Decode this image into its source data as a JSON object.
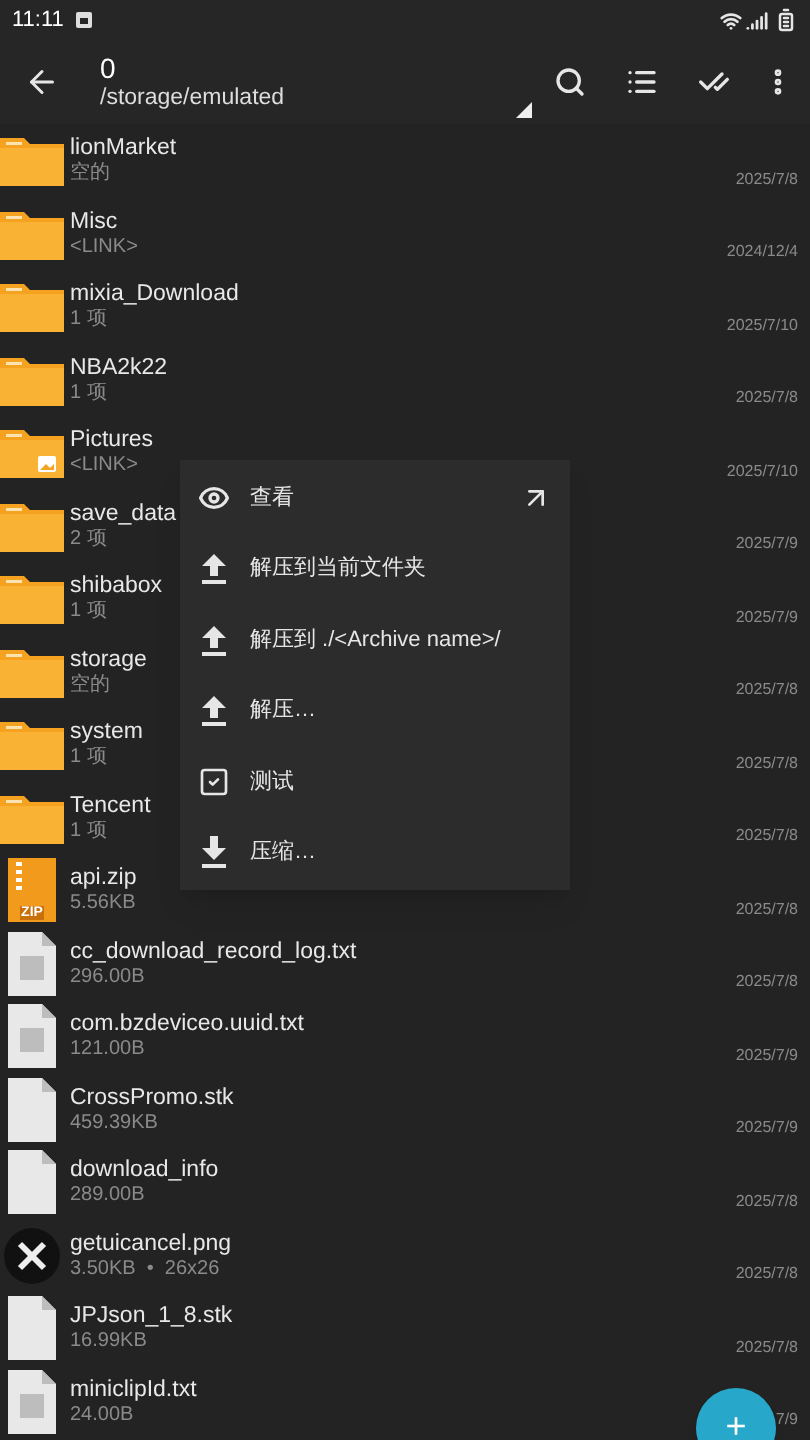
{
  "status_bar": {
    "time": "11:11"
  },
  "app_bar": {
    "title": "0",
    "path": "/storage/emulated"
  },
  "files": [
    {
      "kind": "folder",
      "name": "lionMarket",
      "detail": "空的",
      "date": "2025/7/8"
    },
    {
      "kind": "folder",
      "name": "Misc",
      "detail": "<LINK>",
      "date": "2024/12/4"
    },
    {
      "kind": "folder",
      "name": "mixia_Download",
      "detail": "1 项",
      "date": "2025/7/10"
    },
    {
      "kind": "folder",
      "name": "NBA2k22",
      "detail": "1 项",
      "date": "2025/7/8"
    },
    {
      "kind": "picture-folder",
      "name": "Pictures",
      "detail": "<LINK>",
      "date": "2025/7/10"
    },
    {
      "kind": "folder",
      "name": "save_data",
      "detail": "2 项",
      "date": "2025/7/9"
    },
    {
      "kind": "folder",
      "name": "shibabox",
      "detail": "1 项",
      "date": "2025/7/9"
    },
    {
      "kind": "folder",
      "name": "storage",
      "detail": "空的",
      "date": "2025/7/8"
    },
    {
      "kind": "folder",
      "name": "system",
      "detail": "1 项",
      "date": "2025/7/8"
    },
    {
      "kind": "folder",
      "name": "Tencent",
      "detail": "1 项",
      "date": "2025/7/8"
    },
    {
      "kind": "zip",
      "badge": "ZIP",
      "name": "api.zip",
      "detail": "5.56KB",
      "date": "2025/7/8"
    },
    {
      "kind": "text",
      "name": "cc_download_record_log.txt",
      "detail": "296.00B",
      "date": "2025/7/8"
    },
    {
      "kind": "text",
      "name": "com.bzdeviceo.uuid.txt",
      "detail": "121.00B",
      "date": "2025/7/9"
    },
    {
      "kind": "file",
      "name": "CrossPromo.stk",
      "detail": "459.39KB",
      "date": "2025/7/9"
    },
    {
      "kind": "file",
      "name": "download_info",
      "detail": "289.00B",
      "date": "2025/7/8"
    },
    {
      "kind": "image",
      "name": "getuicancel.png",
      "detail": "3.50KB  •  26x26",
      "date": "2025/7/8"
    },
    {
      "kind": "file",
      "name": "JPJson_1_8.stk",
      "detail": "16.99KB",
      "date": "2025/7/8"
    },
    {
      "kind": "text",
      "name": "miniclipId.txt",
      "detail": "24.00B",
      "date": "7/9"
    }
  ],
  "context_menu": [
    {
      "kind": "view",
      "label": "查看"
    },
    {
      "kind": "extract",
      "label": "解压到当前文件夹"
    },
    {
      "kind": "extract",
      "label": "解压到 ./<Archive name>/"
    },
    {
      "kind": "extract",
      "label": "解压…"
    },
    {
      "kind": "test",
      "label": "测试"
    },
    {
      "kind": "compress",
      "label": "压缩…"
    }
  ],
  "fab": {
    "label": "+"
  }
}
